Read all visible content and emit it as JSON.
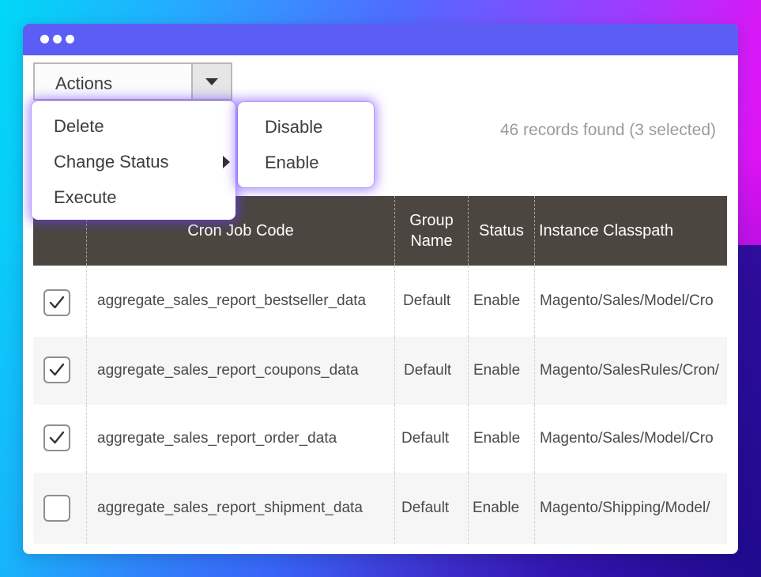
{
  "window": {
    "title_dots": [
      "close-dot",
      "minimize-dot",
      "maximize-dot"
    ]
  },
  "toolbar": {
    "actions_label": "Actions",
    "records_text": "46 records found (3 selected)"
  },
  "actions_menu": {
    "items": [
      "Delete",
      "Change Status",
      "Execute"
    ],
    "submenu": [
      "Disable",
      "Enable"
    ]
  },
  "table": {
    "headers": [
      "",
      "Cron Job Code",
      "Group\nName",
      "Status",
      "Instance Classpath"
    ],
    "rows": [
      {
        "checked": true,
        "code": "aggregate_sales_report_bestseller_data",
        "group": "Default",
        "status": "Enable",
        "classpath": "Magento/Sales/Model/Cro"
      },
      {
        "checked": true,
        "code": "aggregate_sales_report_coupons_data",
        "group": "Default",
        "status": "Enable",
        "classpath": "Magento/SalesRules/Cron/"
      },
      {
        "checked": true,
        "code": "aggregate_sales_report_order_data",
        "group": "Default",
        "status": "Enable",
        "classpath": "Magento/Sales/Model/Cro"
      },
      {
        "checked": false,
        "code": "aggregate_sales_report_shipment_data",
        "group": "Default",
        "status": "Enable",
        "classpath": "Magento/Shipping/Model/"
      }
    ]
  },
  "colors": {
    "titlebar": "#5b5df5",
    "table_header": "#4c4641",
    "menu_glow": "#6e3cff"
  }
}
